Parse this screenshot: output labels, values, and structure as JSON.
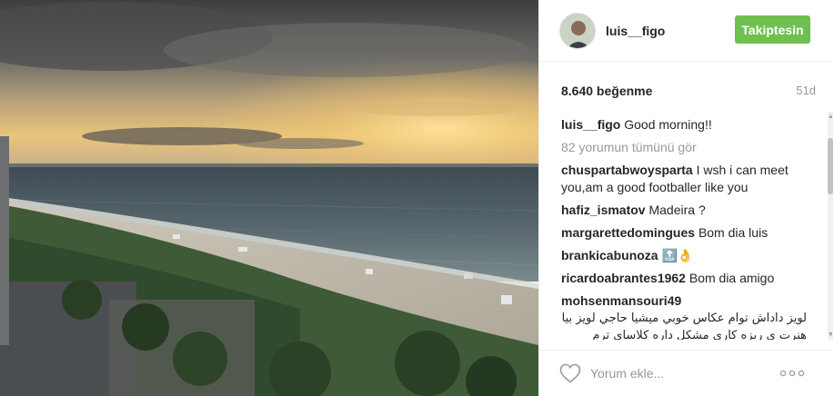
{
  "post": {
    "photo_alt": "",
    "user": {
      "username": "luis__figo"
    },
    "follow_label": "Takiptesin",
    "likes_text": "8.640 beğenme",
    "age_text": "51d",
    "caption": {
      "username": "luis__figo",
      "text": "Good morning!!"
    },
    "view_all_comments": "82 yorumun tümünü gör",
    "comments": [
      {
        "username": "chuspartabwoysparta",
        "text": "I wsh i can meet you,am a good footballer like you"
      },
      {
        "username": "hafiz_ismatov",
        "text": "Madeira ?"
      },
      {
        "username": "margarettedomingues",
        "text": "Bom dia luis"
      },
      {
        "username": "brankicabunoza",
        "text": "🔝👌"
      },
      {
        "username": "ricardoabrantes1962",
        "text": "Bom dia amigo"
      },
      {
        "username": "mohsenmansouri49",
        "text": "لويز داداش توام عكاس خوبي ميشيا حاجي لويز بيا هنرت ي ريزه كاري مشكل داره كلاساي ترم تابستونم شروع شده بردار تخفيفم ميدم"
      }
    ],
    "add_comment_placeholder": "Yorum ekle...",
    "icons": {
      "like": "heart-icon",
      "more": "more-options-icon"
    },
    "colors": {
      "follow_button": "#70c050",
      "muted_text": "#999999"
    }
  }
}
